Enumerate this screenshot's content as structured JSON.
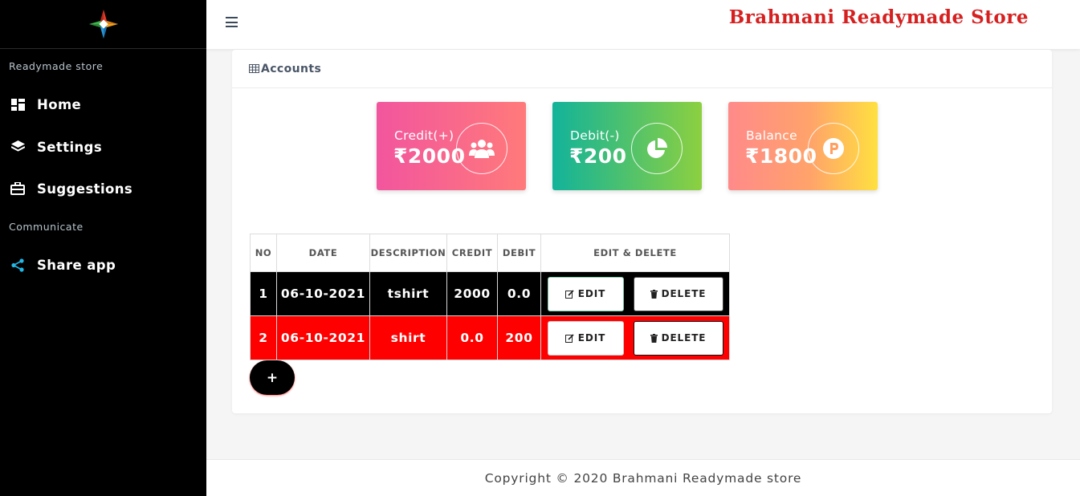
{
  "sidebar": {
    "section_main": "Readymade store",
    "section_communicate": "Communicate",
    "items": [
      {
        "label": "Home",
        "icon": "dashboard-icon"
      },
      {
        "label": "Settings",
        "icon": "layers-icon"
      },
      {
        "label": "Suggestions",
        "icon": "briefcase-icon"
      },
      {
        "label": "Share app",
        "icon": "share-icon"
      }
    ]
  },
  "header": {
    "brand": "Brahmani Readymade Store"
  },
  "card": {
    "title": "Accounts"
  },
  "stats": {
    "credit": {
      "label": "Credit(+)",
      "value": "₹2000",
      "icon": "users-icon"
    },
    "debit": {
      "label": "Debit(-)",
      "value": "₹200",
      "icon": "pie-chart-icon"
    },
    "balance": {
      "label": "Balance",
      "value": "₹1800",
      "icon": "parking-icon"
    }
  },
  "table": {
    "headers": [
      "NO",
      "DATE",
      "DESCRIPTION",
      "CREDIT",
      "DEBIT",
      "EDIT & DELETE"
    ],
    "rows": [
      {
        "no": "1",
        "date": "06-10-2021",
        "description": "tshirt",
        "credit": "2000",
        "debit": "0.0"
      },
      {
        "no": "2",
        "date": "06-10-2021",
        "description": "shirt",
        "credit": "0.0",
        "debit": "200"
      }
    ],
    "edit_label": "EDIT",
    "delete_label": "DELETE"
  },
  "add_button": "+",
  "footer": {
    "copyright": "Copyright © 2020 Brahmani Readymade store"
  },
  "colors": {
    "brand": "#d62020",
    "row_odd": "#000000",
    "row_even": "#ff0000"
  }
}
